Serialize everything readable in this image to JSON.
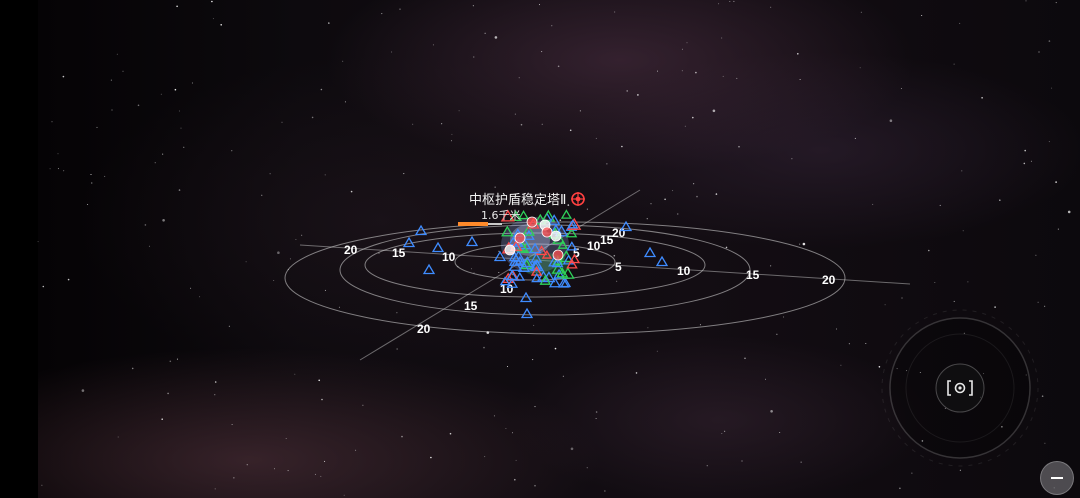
{
  "target": {
    "name": "中枢护盾稳定塔Ⅱ",
    "distance": "1.6千米"
  },
  "radar": {
    "distance_labels": [
      "5",
      "10",
      "15",
      "20"
    ]
  },
  "controls": {
    "camera_icon": "camera-focus-icon",
    "joystick_icon": "joystick-ring-icon",
    "zoom_out_icon": "minus-icon"
  },
  "colors": {
    "friendly": "#3f8cff",
    "enemy": "#ff4a4a",
    "neutral": "#2fd25a",
    "target_marker": "#ff4040"
  }
}
